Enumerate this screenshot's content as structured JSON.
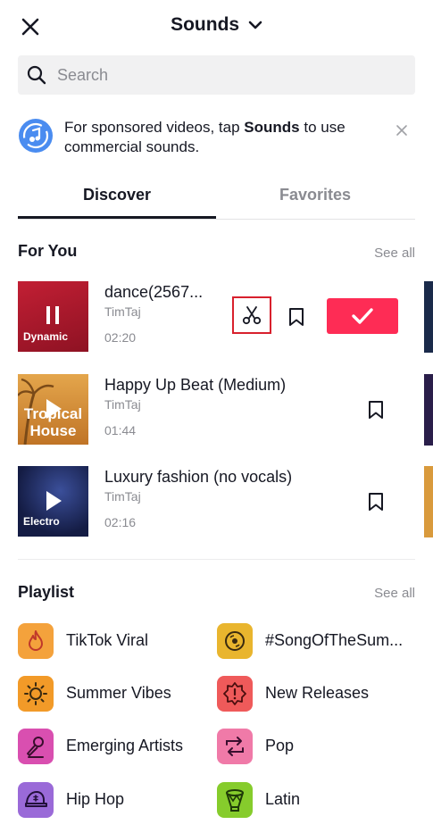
{
  "header": {
    "title": "Sounds"
  },
  "search": {
    "placeholder": "Search",
    "value": ""
  },
  "notice": {
    "text_before": "For sponsored videos, tap ",
    "text_bold": "Sounds",
    "text_after": " to use commercial sounds."
  },
  "tabs": [
    {
      "label": "Discover",
      "active": true
    },
    {
      "label": "Favorites",
      "active": false
    }
  ],
  "for_you": {
    "title": "For You",
    "see_all": "See all",
    "tracks": [
      {
        "name": "dance(2567...",
        "artist": "TimTaj",
        "duration": "02:20",
        "cover_label": "Dynamic",
        "state": "playing",
        "cover_color": "#a8182a"
      },
      {
        "name": "Happy Up Beat (Medium)",
        "artist": "TimTaj",
        "duration": "01:44",
        "cover_label": "Tropical House",
        "state": "paused",
        "cover_color": "#d48a2e"
      },
      {
        "name": "Luxury fashion (no vocals)",
        "artist": "TimTaj",
        "duration": "02:16",
        "cover_label": "Electro",
        "state": "paused",
        "cover_color": "#1c2a5e"
      }
    ]
  },
  "playlist": {
    "title": "Playlist",
    "see_all": "See all",
    "items": [
      {
        "label": "TikTok Viral",
        "icon": "flame-icon",
        "color": "#f4a23c"
      },
      {
        "label": "#SongOfTheSum...",
        "icon": "vinyl-record-icon",
        "color": "#e9b52e"
      },
      {
        "label": "Summer Vibes",
        "icon": "sun-icon",
        "color": "#f29a28"
      },
      {
        "label": "New Releases",
        "icon": "new-badge-icon",
        "color": "#ef5a5a"
      },
      {
        "label": "Emerging Artists",
        "icon": "microphone-icon",
        "color": "#d94fb0"
      },
      {
        "label": "Pop",
        "icon": "repeat-arrows-icon",
        "color": "#f07aa8"
      },
      {
        "label": "Hip Hop",
        "icon": "cap-icon",
        "color": "#9a6ad8"
      },
      {
        "label": "Latin",
        "icon": "drum-icon",
        "color": "#86cc2c"
      }
    ]
  },
  "colors": {
    "accent": "#fe2c55",
    "highlight_box": "#d8202d",
    "notice_icon": "#4a8cf0"
  }
}
